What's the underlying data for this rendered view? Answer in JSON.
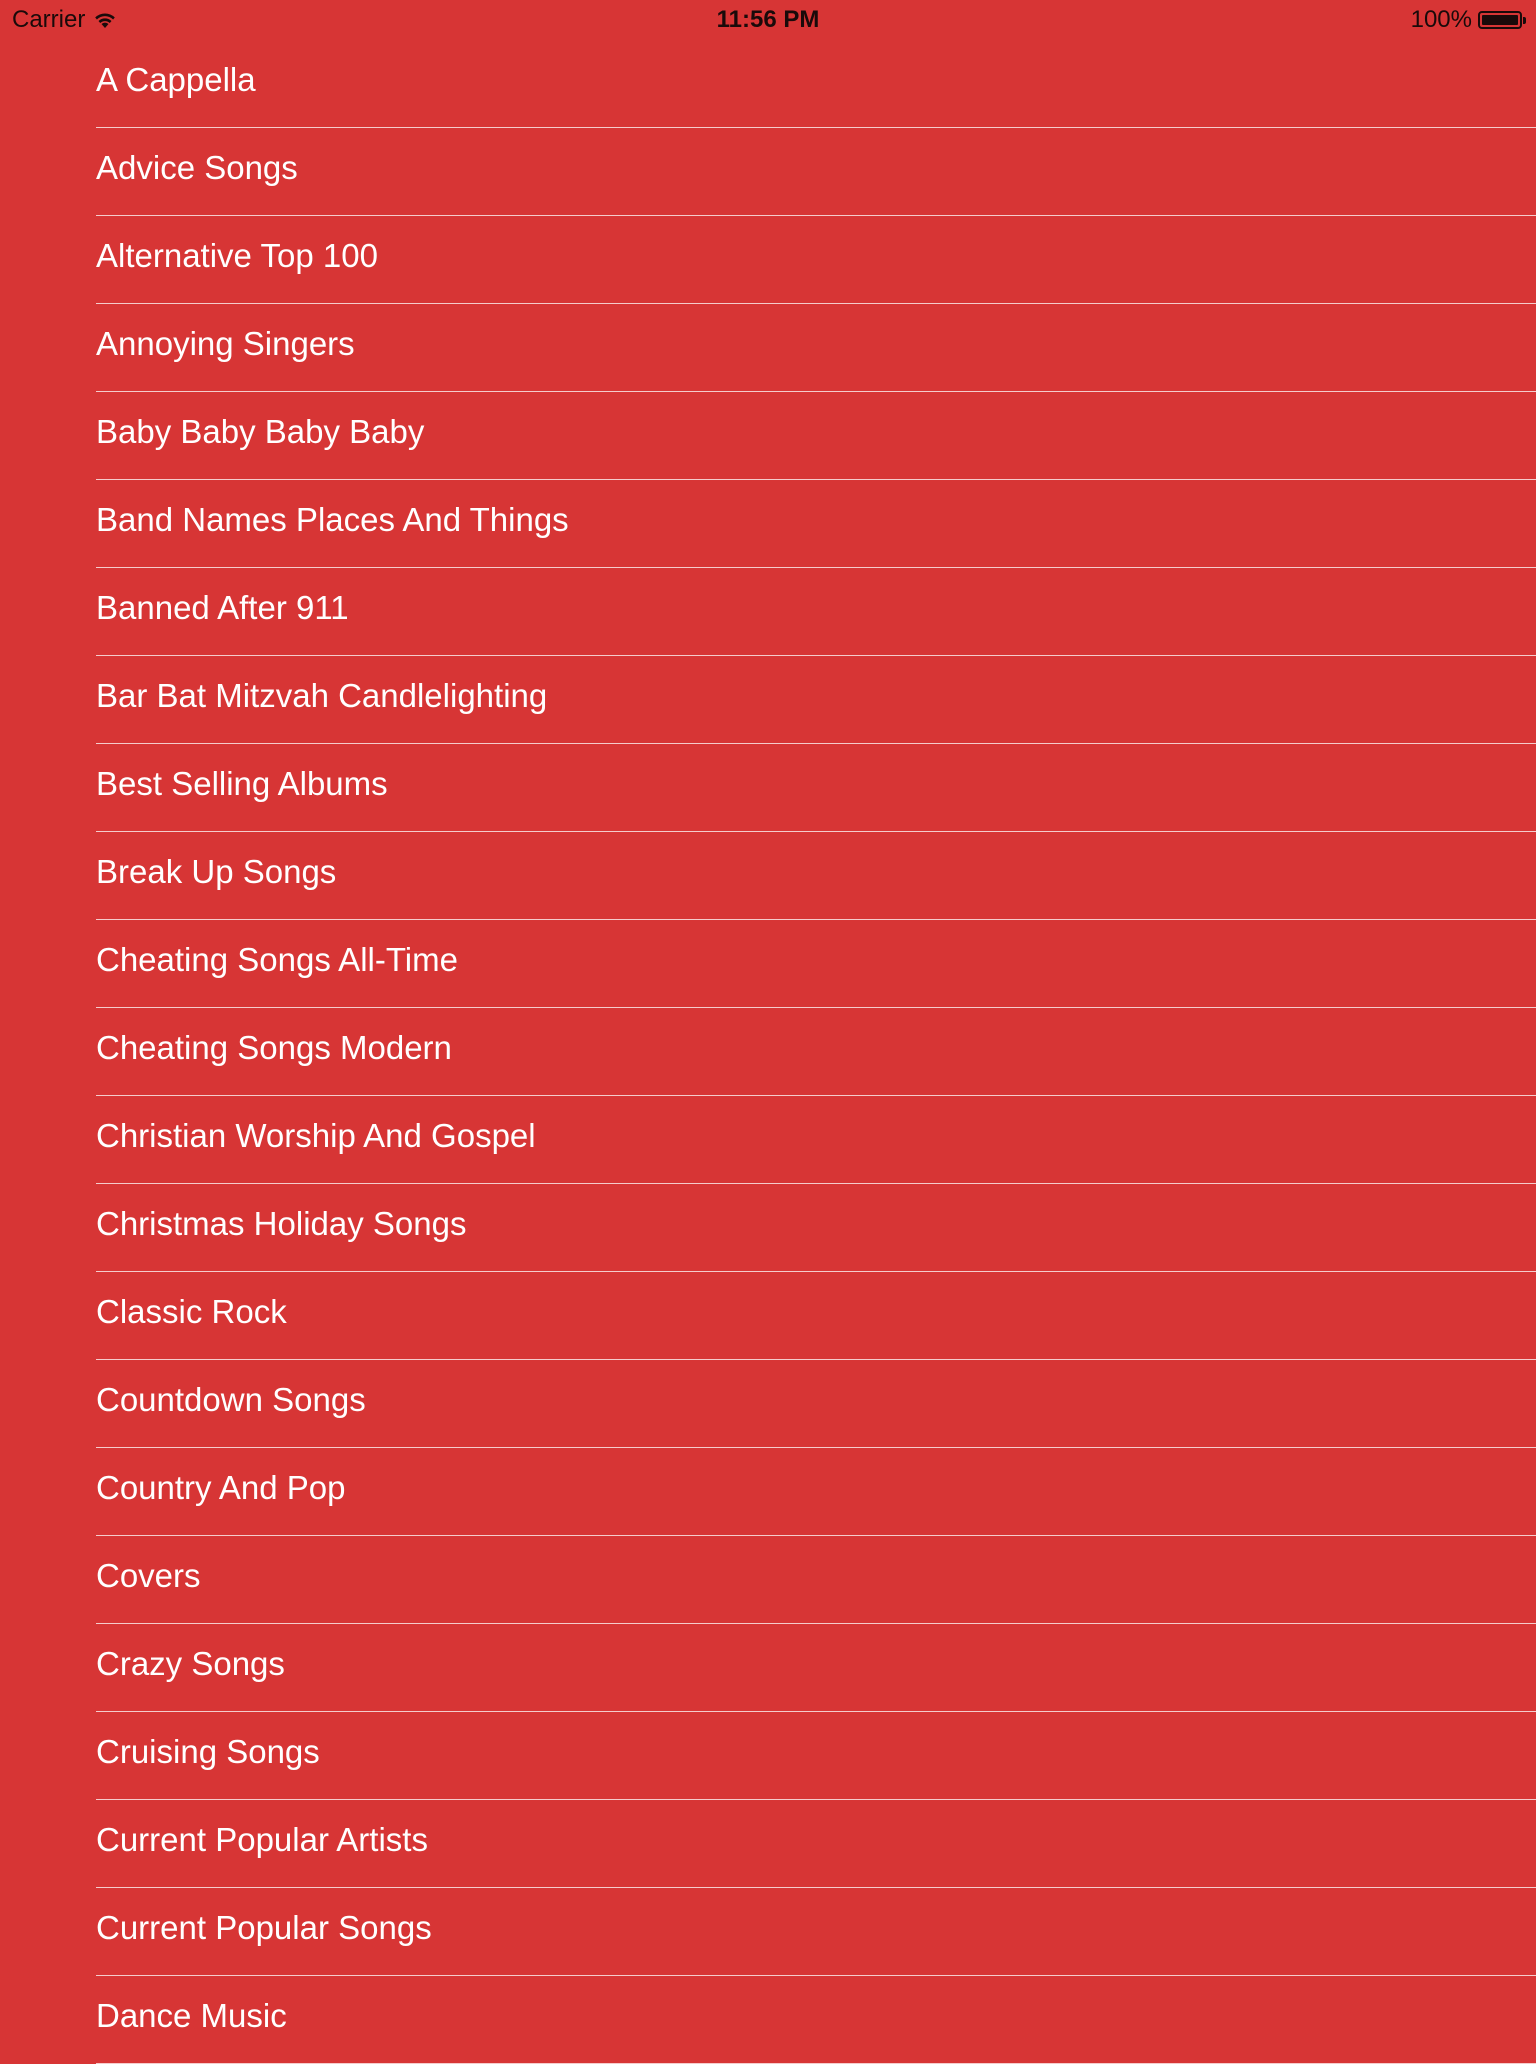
{
  "status_bar": {
    "carrier": "Carrier",
    "time": "11:56 PM",
    "battery": "100%",
    "wifi_icon": "wifi-icon",
    "battery_icon": "battery-icon"
  },
  "colors": {
    "background": "#d73535",
    "text": "#ffffff",
    "separator": "#f2bcbc",
    "status_text": "#1a0a0a"
  },
  "list": {
    "items": [
      {
        "label": "A Cappella"
      },
      {
        "label": "Advice Songs"
      },
      {
        "label": "Alternative Top 100"
      },
      {
        "label": "Annoying Singers"
      },
      {
        "label": "Baby Baby Baby Baby"
      },
      {
        "label": "Band Names Places And Things"
      },
      {
        "label": "Banned After 911"
      },
      {
        "label": "Bar Bat Mitzvah Candlelighting"
      },
      {
        "label": "Best Selling Albums"
      },
      {
        "label": "Break Up Songs"
      },
      {
        "label": "Cheating Songs All-Time"
      },
      {
        "label": "Cheating Songs Modern"
      },
      {
        "label": "Christian Worship And Gospel"
      },
      {
        "label": "Christmas Holiday Songs"
      },
      {
        "label": "Classic Rock"
      },
      {
        "label": "Countdown Songs"
      },
      {
        "label": "Country And Pop"
      },
      {
        "label": "Covers"
      },
      {
        "label": "Crazy Songs"
      },
      {
        "label": "Cruising Songs"
      },
      {
        "label": "Current Popular Artists"
      },
      {
        "label": "Current Popular Songs"
      },
      {
        "label": "Dance Music"
      }
    ]
  }
}
